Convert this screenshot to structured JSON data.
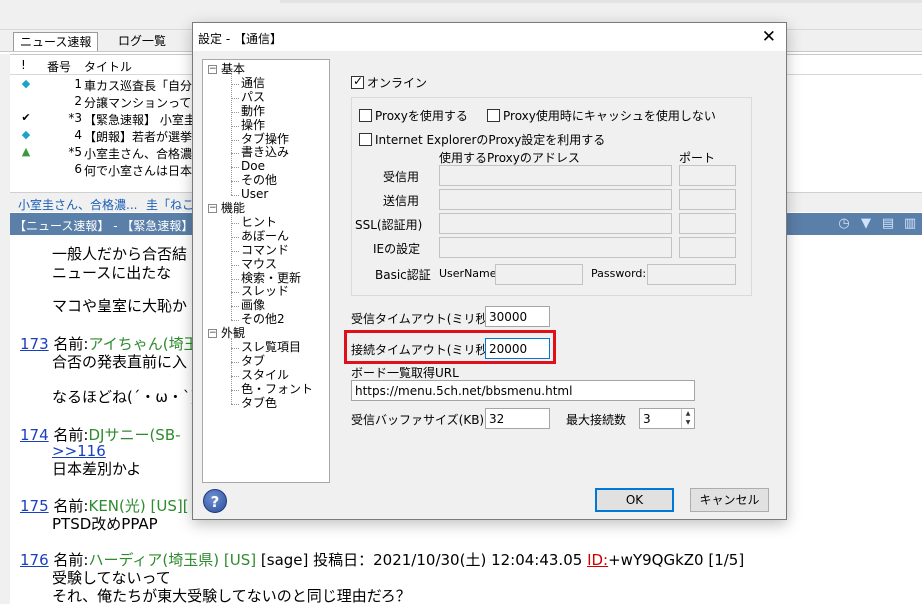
{
  "background": {
    "tabs": [
      "ニュース速報",
      "ログ一覧"
    ],
    "list_head": {
      "mark": "!",
      "number": "番号",
      "title": "タイトル"
    },
    "rows": [
      {
        "mark": "◆",
        "num": "1",
        "title": "車カス巡査長「自分は"
      },
      {
        "mark": "",
        "num": "2",
        "title": "分譲マンションって貸"
      },
      {
        "mark": "✔",
        "num": "*3",
        "title": "【緊急速報】 小室圭"
      },
      {
        "mark": "◆",
        "num": "4",
        "title": "【朗報】若者が選挙に"
      },
      {
        "mark": "▲",
        "num": "*5",
        "title": "小室圭さん、合格濃厚"
      },
      {
        "mark": "",
        "num": "6",
        "title": "何で小室さんは日本で"
      }
    ],
    "strip_tabs": [
      "小室圭さん、合格濃...",
      "圭「ねこカ"
    ],
    "thread_title": "【ニュース速報】 - 【緊急速報】 小室",
    "posts": {
      "l1": "一般人だから合否結",
      "l2": "ニュースに出たな",
      "l3": "マコや皇室に大恥か",
      "p173_num": "173",
      "p173_name_label": "名前:",
      "p173_name": "アイちゃん(埼玉",
      "p173_l1": "合否の発表直前に入",
      "p173_l2": "なるほどね(´・ω・`)",
      "p174_num": "174",
      "p174_name_label": "名前:",
      "p174_name": "DJサニー(SB-",
      "p174_anchor": ">>116",
      "p174_l1": "日本差別かよ",
      "p175_num": "175",
      "p175_name_label": "名前:",
      "p175_name": "KEN(光) [US][",
      "p175_l1": "PTSD改めPPAP",
      "p176_num": "176",
      "p176_name_label": "名前:",
      "p176_name": "ハーディア(埼玉県) [US]",
      "p176_meta": "[sage] 投稿日：2021/10/30(土) 12:04:43.05",
      "p176_id": "ID:",
      "p176_id_val": "+wY9QGkZ0 [1/5]",
      "p176_l1": "受験してないって",
      "p176_l2": "それ、俺たちが東大受験してないのと同じ理由だろ？"
    }
  },
  "dialog": {
    "title": "設定 - 【通信】",
    "close": "✕",
    "tree": [
      {
        "label": "基本",
        "level": 0,
        "toggle": "−"
      },
      {
        "label": "通信",
        "level": 1
      },
      {
        "label": "パス",
        "level": 1
      },
      {
        "label": "動作",
        "level": 1
      },
      {
        "label": "操作",
        "level": 1
      },
      {
        "label": "タブ操作",
        "level": 1
      },
      {
        "label": "書き込み",
        "level": 1
      },
      {
        "label": "Doe",
        "level": 1
      },
      {
        "label": "その他",
        "level": 1
      },
      {
        "label": "User",
        "level": 1
      },
      {
        "label": "機能",
        "level": 0,
        "toggle": "−"
      },
      {
        "label": "ヒント",
        "level": 1
      },
      {
        "label": "あぼーん",
        "level": 1
      },
      {
        "label": "コマンド",
        "level": 1
      },
      {
        "label": "マウス",
        "level": 1
      },
      {
        "label": "検索・更新",
        "level": 1
      },
      {
        "label": "スレッド",
        "level": 1
      },
      {
        "label": "画像",
        "level": 1
      },
      {
        "label": "その他2",
        "level": 1
      },
      {
        "label": "外観",
        "level": 0,
        "toggle": "−"
      },
      {
        "label": "スレ覧項目",
        "level": 1
      },
      {
        "label": "タブ",
        "level": 1
      },
      {
        "label": "スタイル",
        "level": 1
      },
      {
        "label": "色・フォント",
        "level": 1
      },
      {
        "label": "タブ色",
        "level": 1
      }
    ],
    "online_label": "オンライン",
    "proxy_use": "Proxyを使用する",
    "proxy_no_cache": "Proxy使用時にキャッシュを使用しない",
    "ie_proxy": "Internet ExplorerのProxy設定を利用する",
    "proxy_addr_header": "使用するProxyのアドレス",
    "port_header": "ポート",
    "recv_label": "受信用",
    "send_label": "送信用",
    "ssl_label": "SSL(認証用)",
    "ie_label": "IEの設定",
    "basic_auth": "Basic認証",
    "username_label": "UserName:",
    "password_label": "Password:",
    "recv_timeout_label": "受信タイムアウト(ミリ秒)",
    "recv_timeout_value": "30000",
    "conn_timeout_label": "接続タイムアウト(ミリ秒)",
    "conn_timeout_value": "20000",
    "board_url_label": "ボード一覧取得URL",
    "board_url_value": "https://menu.5ch.net/bbsmenu.html",
    "buffer_label": "受信バッファサイズ(KB)",
    "buffer_value": "32",
    "max_conn_label": "最大接続数",
    "max_conn_value": "3",
    "ok": "OK",
    "cancel": "キャンセル",
    "help_glyph": "?"
  },
  "colors": {
    "highlight": "#e0101a",
    "accent": "#0078d7",
    "link": "#1a3fbf",
    "name_green": "#2e8b2e"
  }
}
